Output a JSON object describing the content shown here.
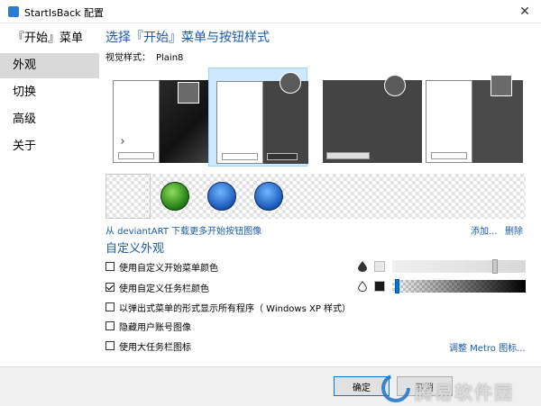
{
  "window": {
    "title": "StartIsBack 配置",
    "close_glyph": "✕"
  },
  "sidebar": {
    "items": [
      {
        "label": "『开始』菜单",
        "active": false
      },
      {
        "label": "外观",
        "active": true
      },
      {
        "label": "切换",
        "active": false
      },
      {
        "label": "高级",
        "active": false
      },
      {
        "label": "关于",
        "active": false
      }
    ]
  },
  "main": {
    "title": "选择『开始』菜单与按钮样式",
    "visual_style_label": "视觉样式：",
    "visual_style_value": "Plain8",
    "selected_style_index": 1,
    "deviantart_link": "从 deviantART 下载更多开始按钮图像",
    "add_link": "添加...",
    "delete_link": "删除",
    "custom_title": "自定义外观",
    "options": [
      {
        "label": "使用自定义开始菜单颜色",
        "checked": false
      },
      {
        "label": "使用自定义任务栏颜色",
        "checked": true
      },
      {
        "label": "以弹出式菜单的形式显示所有程序（ Windows XP 样式）",
        "checked": false
      },
      {
        "label": "隐藏用户账号图像",
        "checked": false
      },
      {
        "label": "使用大任务栏图标",
        "checked": false
      }
    ],
    "metro_link": "调整 Metro 图标...",
    "colors": {
      "accent": "#1a5aa8",
      "start_menu_swatch": "#e8e8e8",
      "taskbar_swatch": "#1a1a1a",
      "taskbar_slider_marker": "#0078d7"
    },
    "sliders": {
      "start_menu_position": 0.78,
      "taskbar_position": 0.02
    },
    "icons": [
      "drop-filled-icon",
      "drop-outline-icon",
      "user-icon",
      "clover-orb-icon",
      "windows-orb-icon"
    ]
  },
  "footer": {
    "ok_label": "确定",
    "cancel_label": "取消",
    "watermark_text": "腾易软件园"
  }
}
